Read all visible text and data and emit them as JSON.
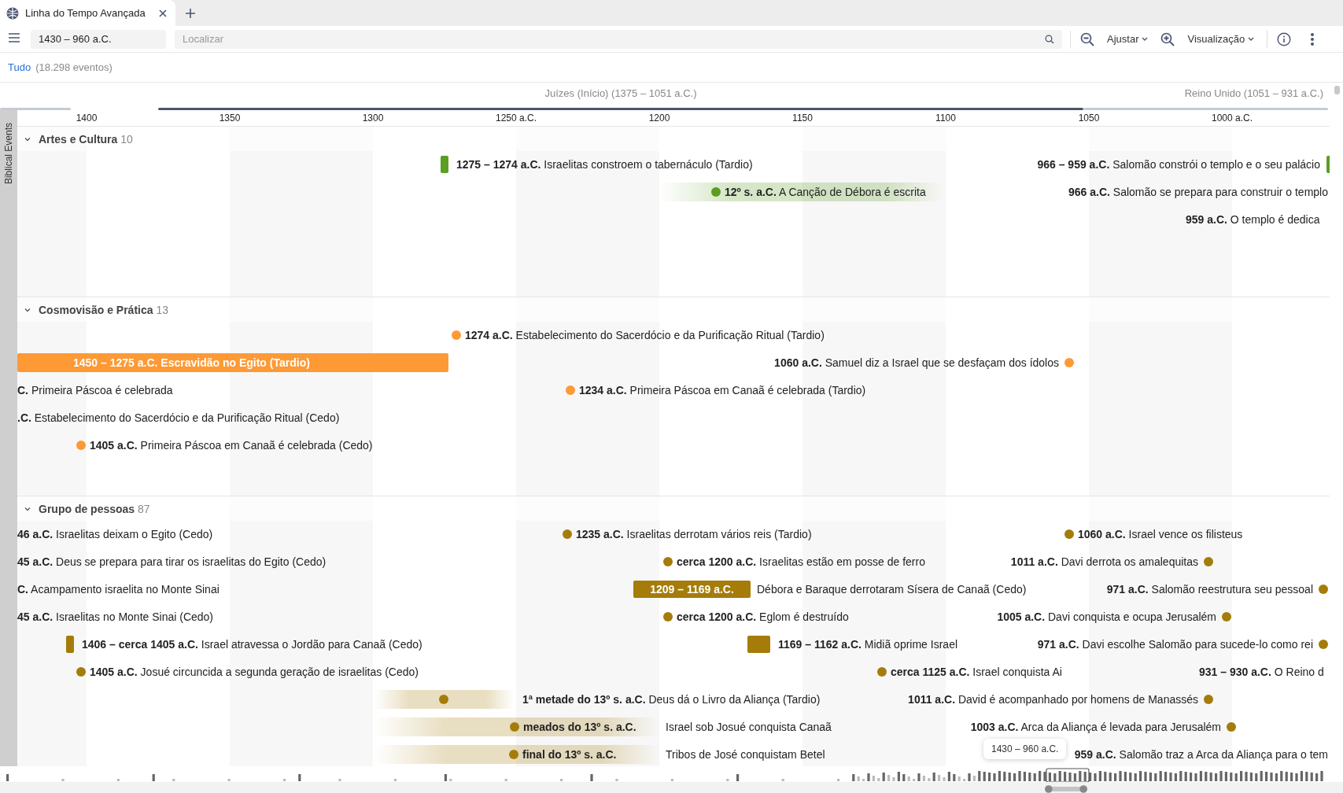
{
  "tab": {
    "title": "Linha do Tempo Avançada",
    "selected": true
  },
  "toolbar": {
    "date_range": "1430 – 960 a.C.",
    "search": {
      "placeholder": "Localizar"
    },
    "fit_label": "Ajustar",
    "view_label": "Visualização"
  },
  "filter": {
    "label": "Tudo",
    "count": "(18.298 eventos)"
  },
  "periods": [
    {
      "label": "Juízes (Início) (1375 – 1051 a.C.)",
      "highlighted": true
    },
    {
      "label": "Reino Unido (1051 – 931 a.C.)",
      "highlighted": false
    }
  ],
  "ruler": {
    "ticks": [
      "1400",
      "1350",
      "1300",
      "1250 a.C.",
      "1200",
      "1150",
      "1100",
      "1050",
      "1000 a.C."
    ]
  },
  "side_label": "Biblical Events",
  "groups": [
    {
      "label": "Artes e Cultura",
      "count": "10",
      "expanded": true,
      "color": "#5a9e22",
      "events": [
        {
          "kind": "marker",
          "date": "1275 – 1274 a.C.",
          "title": "Israelitas constroem o tabernáculo (Tardio)"
        },
        {
          "kind": "marker-end",
          "date": "966 – 959 a.C.",
          "title": "Salomão constrói o templo e o seu palácio"
        },
        {
          "kind": "fuzzy",
          "date": "12º s. a.C.",
          "title": "A Canção de Débora é escrita"
        },
        {
          "kind": "text",
          "date": "966 a.C.",
          "title": "Salomão se prepara para construir o templo"
        },
        {
          "kind": "text",
          "date": "959 a.C.",
          "title": "O templo é dedica"
        }
      ]
    },
    {
      "label": "Cosmovisão e Prática",
      "count": "13",
      "expanded": true,
      "color": "#fd9a35",
      "events": [
        {
          "kind": "dot",
          "date": "1274 a.C.",
          "title": "Estabelecimento do Sacerdócio e da Purificação Ritual (Tardio)"
        },
        {
          "kind": "bar",
          "date": "1450 – 1275 a.C.",
          "title": "Escravidão no Egito (Tardio)"
        },
        {
          "kind": "dot-end",
          "date": "1060 a.C.",
          "title": "Samuel diz a Israel que se desfaçam dos ídolos"
        },
        {
          "kind": "text",
          "date": "C.",
          "title": "Primeira Páscoa é celebrada"
        },
        {
          "kind": "dot",
          "date": "1234 a.C.",
          "title": "Primeira Páscoa em Canaã é celebrada (Tardio)"
        },
        {
          "kind": "text",
          "date": ".C.",
          "title": "Estabelecimento do Sacerdócio e da Purificação Ritual (Cedo)"
        },
        {
          "kind": "dot",
          "date": "1405 a.C.",
          "title": "Primeira Páscoa em Canaã é celebrada (Cedo)"
        }
      ]
    },
    {
      "label": "Grupo de pessoas",
      "count": "87",
      "expanded": true,
      "color": "#a57c0a",
      "events": [
        {
          "kind": "text",
          "date": "46 a.C.",
          "title": "Israelitas deixam o Egito (Cedo)"
        },
        {
          "kind": "dot",
          "date": "1235 a.C.",
          "title": "Israelitas derrotam vários reis (Tardio)"
        },
        {
          "kind": "dot",
          "date": "1060 a.C.",
          "title": "Israel vence os filisteus"
        },
        {
          "kind": "text",
          "date": "45 a.C.",
          "title": "Deus se prepara para tirar os israelitas do Egito (Cedo)"
        },
        {
          "kind": "dot",
          "date": "cerca 1200 a.C.",
          "title": "Israelitas estão em posse de ferro"
        },
        {
          "kind": "dot-end",
          "date": "1011 a.C.",
          "title": "Davi derrota os amalequitas"
        },
        {
          "kind": "text",
          "date": "C.",
          "title": "Acampamento israelita no Monte Sinai"
        },
        {
          "kind": "box-date",
          "date": "1209 – 1169 a.C.",
          "title": "Débora e Baraque derrotaram Sísera de Canaã (Cedo)"
        },
        {
          "kind": "dot-end",
          "date": "971 a.C.",
          "title": "Salomão reestrutura seu pessoal"
        },
        {
          "kind": "text",
          "date": "45 a.C.",
          "title": "Israelitas no Monte Sinai (Cedo)"
        },
        {
          "kind": "dot",
          "date": "cerca 1200 a.C.",
          "title": "Eglom é destruído"
        },
        {
          "kind": "dot-end",
          "date": "1005 a.C.",
          "title": "Davi conquista e ocupa Jerusalém"
        },
        {
          "kind": "marker",
          "date": "1406 – cerca 1405 a.C.",
          "title": "Israel atravessa o Jordão para Canaã (Cedo)"
        },
        {
          "kind": "marker",
          "date": "1169 – 1162 a.C.",
          "title": "Midiã oprime Israel"
        },
        {
          "kind": "dot-end",
          "date": "971 a.C.",
          "title": "Davi escolhe Salomão para sucede-lo como rei"
        },
        {
          "kind": "dot",
          "date": "1405 a.C.",
          "title": "Josué circuncida a segunda geração de israelitas (Cedo)"
        },
        {
          "kind": "dot",
          "date": "cerca 1125 a.C.",
          "title": "Israel conquista Ai"
        },
        {
          "kind": "text",
          "date": "931 – 930 a.C.",
          "title": "O Reino d"
        },
        {
          "kind": "fuzzy",
          "date": "1ª metade do 13º s. a.C.",
          "title": "Deus dá o Livro da Aliança (Tardio)"
        },
        {
          "kind": "dot-end",
          "date": "1011 a.C.",
          "title": "David é acompanhado por homens de Manassés"
        },
        {
          "kind": "fuzzy",
          "date": "meados do 13º s. a.C.",
          "title": "Israel sob Josué conquista Canaã"
        },
        {
          "kind": "dot-end",
          "date": "1003 a.C.",
          "title": "Arca da Aliança é levada para Jerusalém"
        },
        {
          "kind": "fuzzy",
          "date": "final do 13º s. a.C.",
          "title": "Tribos de José conquistam Betel"
        },
        {
          "kind": "text",
          "date": "959 a.C.",
          "title": "Salomão traz a Arca da Aliança para o tem"
        }
      ]
    }
  ],
  "tooltip": "1430 – 960 a.C."
}
